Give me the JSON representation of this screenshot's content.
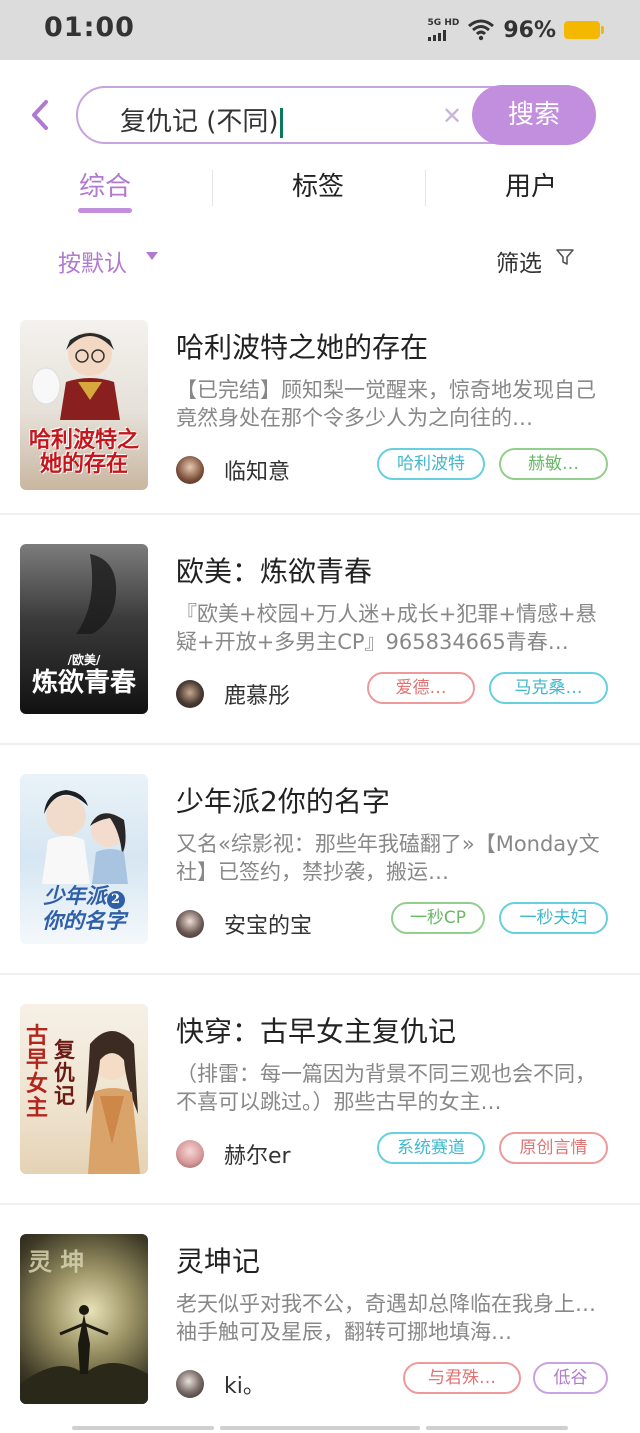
{
  "status_bar": {
    "time": "01:00",
    "network": "5G HD",
    "battery": "96%"
  },
  "search": {
    "query": "复仇记 (不同",
    "button_label": "搜索"
  },
  "tabs": [
    {
      "label": "综合",
      "active": true
    },
    {
      "label": "标签",
      "active": false
    },
    {
      "label": "用户",
      "active": false
    }
  ],
  "filters": {
    "sort_label": "按默认",
    "filter_label": "筛选"
  },
  "colors": {
    "accent": "#c28ede",
    "accent_text": "#b07ad0"
  },
  "books": [
    {
      "title": "哈利波特之她的存在",
      "description": "【已完结】顾知梨一觉醒来，惊奇地发现自己竟然身处在那个令多少人为之向往的…",
      "author": "临知意",
      "cover_text": "哈利波特之她的存在",
      "tags": [
        {
          "label": "哈利波特",
          "color": "cyan"
        },
        {
          "label": "赫敏…",
          "color": "green"
        }
      ]
    },
    {
      "title": "欧美：炼欲青春",
      "description": "『欧美+校园+万人迷+成长+犯罪+情感+悬疑+开放+多男主CP』965834665青春…",
      "author": "鹿慕彤",
      "cover_text": "炼欲青春",
      "tags": [
        {
          "label": "爱德…",
          "color": "red"
        },
        {
          "label": "马克桑…",
          "color": "cyan"
        }
      ]
    },
    {
      "title": "少年派2你的名字",
      "description": "又名«综影视：那些年我磕翻了»【Monday文社】已签约，禁抄袭，搬运…",
      "author": "安宝的宝",
      "cover_text": "少年派你的名字",
      "tags": [
        {
          "label": "一秒CP",
          "color": "green"
        },
        {
          "label": "一秒夫妇",
          "color": "cyan"
        }
      ]
    },
    {
      "title": "快穿：古早女主复仇记",
      "description": "（排雷：每一篇因为背景不同三观也会不同，不喜可以跳过。）那些古早的女主…",
      "author": "赫尔er",
      "cover_text": "古早女主复仇记",
      "tags": [
        {
          "label": "系统赛道",
          "color": "cyan"
        },
        {
          "label": "原创言情",
          "color": "red"
        }
      ]
    },
    {
      "title": "灵坤记",
      "description": "老天似乎对我不公，奇遇却总降临在我身上…袖手触可及星辰，翻转可挪地填海…",
      "author": "ki。",
      "cover_text": "灵坤记",
      "tags": [
        {
          "label": "与君殊…",
          "color": "red"
        },
        {
          "label": "低谷",
          "color": "purple"
        }
      ]
    }
  ]
}
